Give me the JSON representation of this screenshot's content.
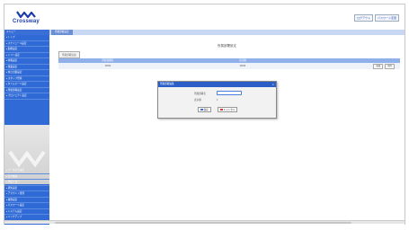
{
  "header": {
    "logo_text": "Crossway",
    "links": [
      "ログアウト",
      "パスワード変更"
    ]
  },
  "breadcrumb": {
    "nav_head": "メニュー",
    "current": "所属部署設定"
  },
  "sidebar": {
    "upper_items": [
      "トップ",
      "スケジュール設定",
      "勤務設定",
      "シフト設定",
      "休暇設定",
      "残業設定",
      "休日出勤設定",
      "スタッフ登録",
      "タイムカード設定",
      "所属部署設定",
      "プロジェクト設定"
    ],
    "lower_items": [
      "データ出力設定",
      "ログ確認",
      "承認フロー",
      "通知設定",
      "アカウント管理",
      "権限設定",
      "パスワード設定",
      "システム設定",
      "バックアップ"
    ]
  },
  "main": {
    "title": "所属部署設定",
    "add_button": "所属部署追加",
    "columns": [
      "所属部署名",
      "表示順"
    ],
    "rows": [
      {
        "name": "0000",
        "order": "0000"
      }
    ],
    "row_actions": [
      "編集",
      "削除"
    ]
  },
  "modal": {
    "title": "所属部署編集",
    "close": "×",
    "field_label": "所属部署名",
    "field_value": "",
    "order_label": "表示順",
    "order_value": "1",
    "save_button": "保存",
    "cancel_button": "キャンセル"
  },
  "colors": {
    "accent": "#2f6ad6",
    "header_bar": "#c9d8f2",
    "modal_header": "#2b5fc7"
  }
}
